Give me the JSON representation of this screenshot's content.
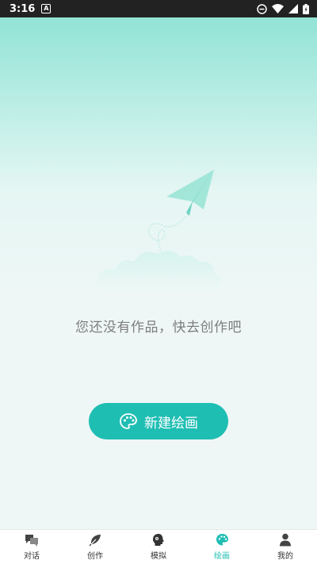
{
  "status_bar": {
    "time": "3:16",
    "notification": "A",
    "icons": [
      "dnd-icon",
      "wifi-icon",
      "signal-icon",
      "battery-icon"
    ]
  },
  "empty_state": {
    "message": "您还没有作品，快去创作吧",
    "illustration": "paper-plane-cloud-illustration"
  },
  "new_button": {
    "label": "新建绘画",
    "icon": "palette-icon"
  },
  "tabs": [
    {
      "label": "对话",
      "icon": "chat-icon",
      "active": false
    },
    {
      "label": "创作",
      "icon": "feather-icon",
      "active": false
    },
    {
      "label": "模拟",
      "icon": "head-silhouette-icon",
      "active": false
    },
    {
      "label": "绘画",
      "icon": "palette-icon",
      "active": true
    },
    {
      "label": "我的",
      "icon": "person-icon",
      "active": false
    }
  ],
  "colors": {
    "accent": "#1fbeb3",
    "header_gradient_top": "#92e3d6",
    "background": "#eff7f6",
    "text_gray": "#7e7e7e"
  }
}
